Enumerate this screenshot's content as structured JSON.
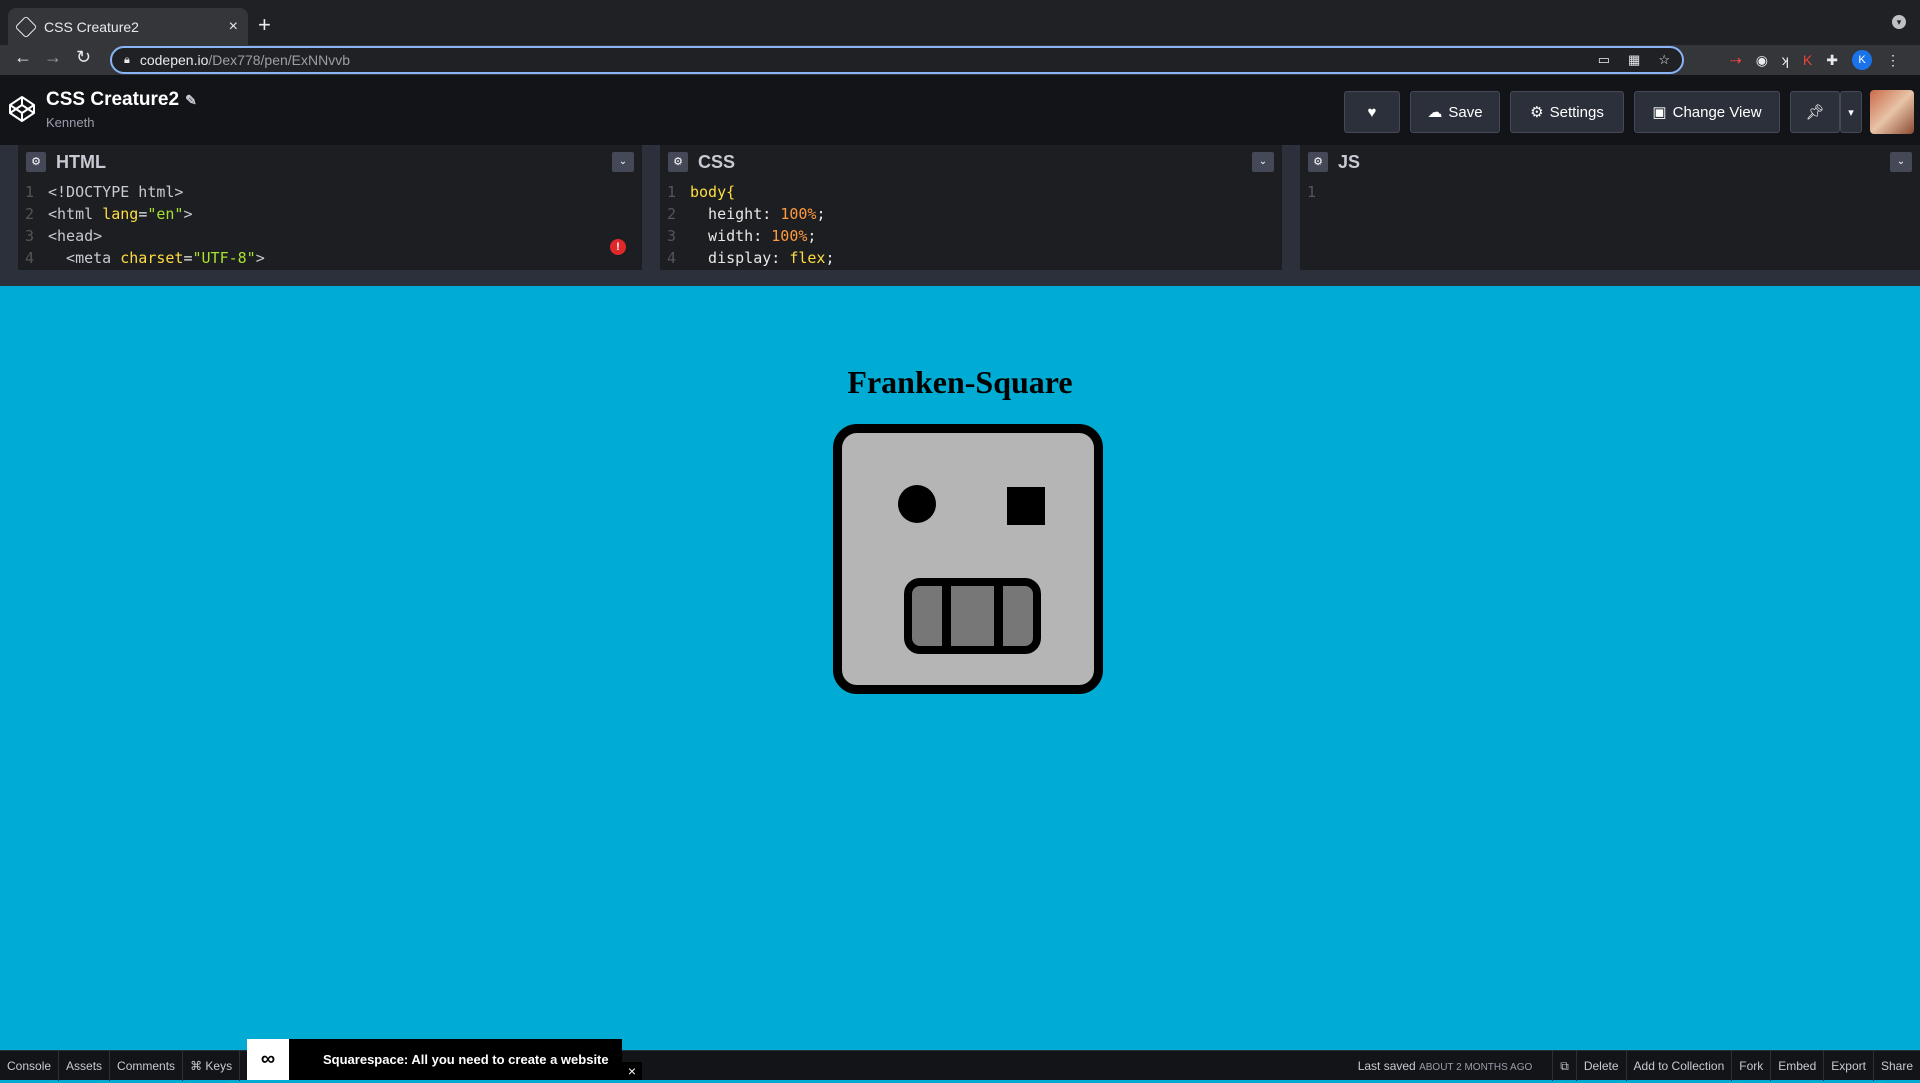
{
  "browser": {
    "tab_title": "CSS Creature2",
    "tab_close": "×",
    "new_tab": "+",
    "url_host": "codepen.io",
    "url_path": "/Dex778/pen/ExNNvvb",
    "profile_initial": "K"
  },
  "codepen": {
    "pen_title": "CSS Creature2",
    "author": "Kenneth",
    "buttons": {
      "save": "Save",
      "settings": "Settings",
      "change_view": "Change View"
    }
  },
  "editors": {
    "html": {
      "label": "HTML",
      "lines": [
        {
          "n": "1",
          "text": "<!DOCTYPE html>"
        },
        {
          "n": "2",
          "tag_open": "<html ",
          "attr": "lang",
          "eq": "=",
          "str": "\"en\"",
          "tag_close": ">"
        },
        {
          "n": "3",
          "text": "<head>"
        },
        {
          "n": "4",
          "tag_open": "  <meta ",
          "attr": "charset",
          "eq": "=",
          "str": "\"UTF-8\"",
          "tag_close": ">"
        }
      ]
    },
    "css": {
      "label": "CSS",
      "lines": [
        {
          "n": "1",
          "selector": "body{"
        },
        {
          "n": "2",
          "prop": "  height: ",
          "value": "100%",
          "end": ";"
        },
        {
          "n": "3",
          "prop": "  width: ",
          "value": "100%",
          "end": ";"
        },
        {
          "n": "4",
          "prop": "  display: ",
          "value": "flex",
          "end": ";"
        }
      ]
    },
    "js": {
      "label": "JS",
      "lines": [
        {
          "n": "1"
        }
      ]
    }
  },
  "preview": {
    "heading": "Franken-Square"
  },
  "status_bar": {
    "console": "Console",
    "assets": "Assets",
    "comments": "Comments",
    "keys": "⌘ Keys",
    "last_saved": "Last saved",
    "last_saved_when": "ABOUT 2 MONTHS AGO",
    "delete": "Delete",
    "add_to_collection": "Add to Collection",
    "fork": "Fork",
    "embed": "Embed",
    "export": "Export",
    "share": "Share"
  },
  "ad": {
    "text": "Squarespace: All you need to create a website",
    "close": "×"
  },
  "colors": {
    "preview_bg": "#00acd4",
    "creature_face": "#b5b5b5",
    "creature_teeth": "#777777",
    "header_bg": "#131417"
  },
  "icons": [
    "codepen-logo-icon",
    "edit-pencil-icon",
    "heart-icon",
    "cloud-icon",
    "gear-icon",
    "layout-icon",
    "pin-icon",
    "chevron-down-icon",
    "lock-icon",
    "star-icon",
    "extensions-icon",
    "error-icon",
    "squarespace-logo-icon",
    "close-icon"
  ]
}
